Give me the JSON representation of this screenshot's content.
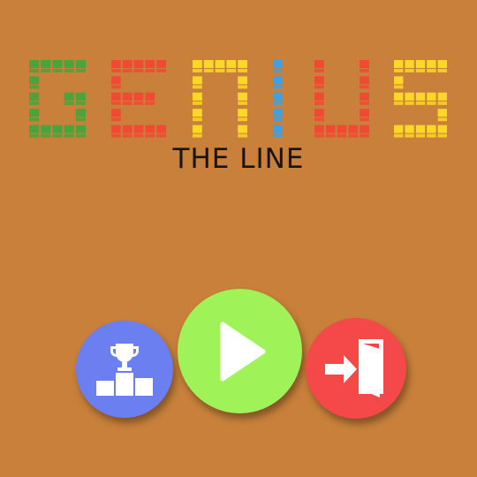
{
  "title": {
    "letters": [
      {
        "char": "G",
        "color": "#49a43b"
      },
      {
        "char": "E",
        "color": "#f04a35"
      },
      {
        "char": "N",
        "color": "#fbd727"
      },
      {
        "char": "I",
        "color": "#3fa0e6"
      },
      {
        "char": "U",
        "color": "#f04a35"
      },
      {
        "char": "S",
        "color": "#fbd727"
      }
    ],
    "subtitle": "THE LINE"
  },
  "buttons": {
    "leaderboard": {
      "icon": "trophy-podium-icon",
      "color": "#6b7ff0"
    },
    "play": {
      "icon": "play-icon",
      "color": "#9ff258"
    },
    "exit": {
      "icon": "exit-door-icon",
      "color": "#f54848"
    }
  },
  "background_color": "#c8803a"
}
